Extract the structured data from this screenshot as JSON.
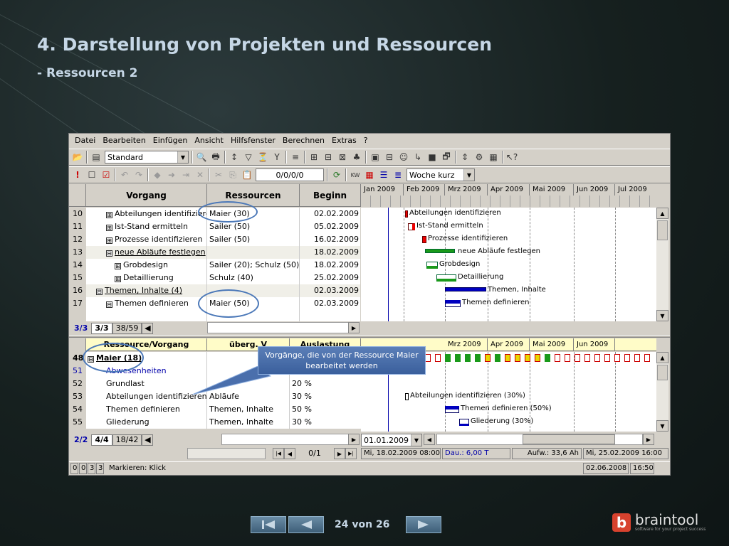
{
  "slide": {
    "title": "4. Darstellung von Projekten und Ressourcen",
    "subtitle": "- Ressourcen 2",
    "nav_label": "24 von 26",
    "brand_name": "braintool",
    "brand_tagline": "software for your project success",
    "brand_mark": "b"
  },
  "menu": [
    "Datei",
    "Bearbeiten",
    "Einfügen",
    "Ansicht",
    "Hilfsfenster",
    "Berechnen",
    "Extras",
    "?"
  ],
  "toolbar1": {
    "view_combo": "Standard"
  },
  "toolbar2": {
    "date_field": "0/0/0/0",
    "scale_combo": "Woche kurz"
  },
  "upper": {
    "headers": {
      "task": "Vorgang",
      "resources": "Ressourcen",
      "start": "Beginn"
    },
    "months": [
      "Jan 2009",
      "Feb 2009",
      "Mrz 2009",
      "Apr 2009",
      "Mai 2009",
      "Jun 2009",
      "Jul 2009"
    ],
    "rows": [
      {
        "num": "10",
        "box": "⊞",
        "task": "Abteilungen identifiziere",
        "resources": "Maier (30)",
        "start": "02.02.2009",
        "indent": 1
      },
      {
        "num": "11",
        "box": "⊞",
        "task": "Ist-Stand ermitteln",
        "resources": "Sailer (50)",
        "start": "05.02.2009",
        "indent": 1
      },
      {
        "num": "12",
        "box": "⊞",
        "task": "Prozesse identifizieren",
        "resources": "Sailer (50)",
        "start": "16.02.2009",
        "indent": 1
      },
      {
        "num": "13",
        "box": "⊟",
        "task": "neue Abläufe festlegen",
        "resources": "",
        "start": "18.02.2009",
        "indent": 1
      },
      {
        "num": "14",
        "box": "⊞",
        "task": "Grobdesign",
        "resources": "Sailer (20); Schulz (50)",
        "start": "18.02.2009",
        "indent": 2
      },
      {
        "num": "15",
        "box": "⊞",
        "task": "Detaillierung",
        "resources": "Schulz (40)",
        "start": "25.02.2009",
        "indent": 2
      },
      {
        "num": "16",
        "box": "⊟",
        "task": "Themen, Inhalte (4)",
        "resources": "",
        "start": "02.03.2009",
        "indent": 0
      },
      {
        "num": "17",
        "box": "⊟",
        "task": "Themen definieren",
        "resources": "Maier (50)",
        "start": "02.03.2009",
        "indent": 1
      }
    ],
    "gantt_labels": [
      "Abteilungen identifizieren",
      "Ist-Stand ermitteln",
      "Prozesse identifizieren",
      "neue Abläufe festlegen",
      "Grobdesign",
      "Detaillierung",
      "Themen, Inhalte",
      "Themen definieren"
    ],
    "tabs": {
      "a": "3/3",
      "b": "3/3",
      "c": "38/59"
    }
  },
  "lower": {
    "headers": {
      "resource": "Ressource/Vorgang",
      "parent": "überg. V",
      "load": "Auslastung"
    },
    "months": [
      "Mrz 2009",
      "Apr 2009",
      "Mai 2009",
      "Jun 2009"
    ],
    "rows": [
      {
        "num": "48",
        "box": "⊟",
        "name": "Maier (18)",
        "parent": "",
        "load": ""
      },
      {
        "num": "51",
        "box": "",
        "name": "Abwesenheiten",
        "parent": "",
        "load": ""
      },
      {
        "num": "52",
        "box": "",
        "name": "Grundlast",
        "parent": "",
        "load": "20 %"
      },
      {
        "num": "53",
        "box": "",
        "name": "Abteilungen identifizieren",
        "parent": "Abläufe",
        "load": "30 %"
      },
      {
        "num": "54",
        "box": "",
        "name": "Themen definieren",
        "parent": "Themen, Inhalte",
        "load": "50 %"
      },
      {
        "num": "55",
        "box": "",
        "name": "Gliederung",
        "parent": "Themen, Inhalte",
        "load": "30 %"
      }
    ],
    "gantt_labels": [
      "Abteilungen identifizieren (30%)",
      "Themen definieren (50%)",
      "Gliederung (30%)"
    ],
    "tabs": {
      "a": "2/2",
      "b": "4/4",
      "c": "18/42"
    },
    "date_combo": "01.01.2009"
  },
  "callout": "Vorgänge, die von der Ressource Maier bearbeitet werden",
  "recordbar": {
    "pos": "0/1"
  },
  "statusbar": {
    "cell1": "Mi, 18.02.2009 08:00",
    "cell2": "Dau.: 6,00 T",
    "cell3": "Aufw.: 33,6 Ah",
    "cell4": "Mi, 25.02.2009 16:00",
    "left_nums": [
      "0",
      "0",
      "3",
      "3"
    ],
    "mode": "Markieren: Klick",
    "date": "02.06.2008",
    "time": "16:50"
  }
}
